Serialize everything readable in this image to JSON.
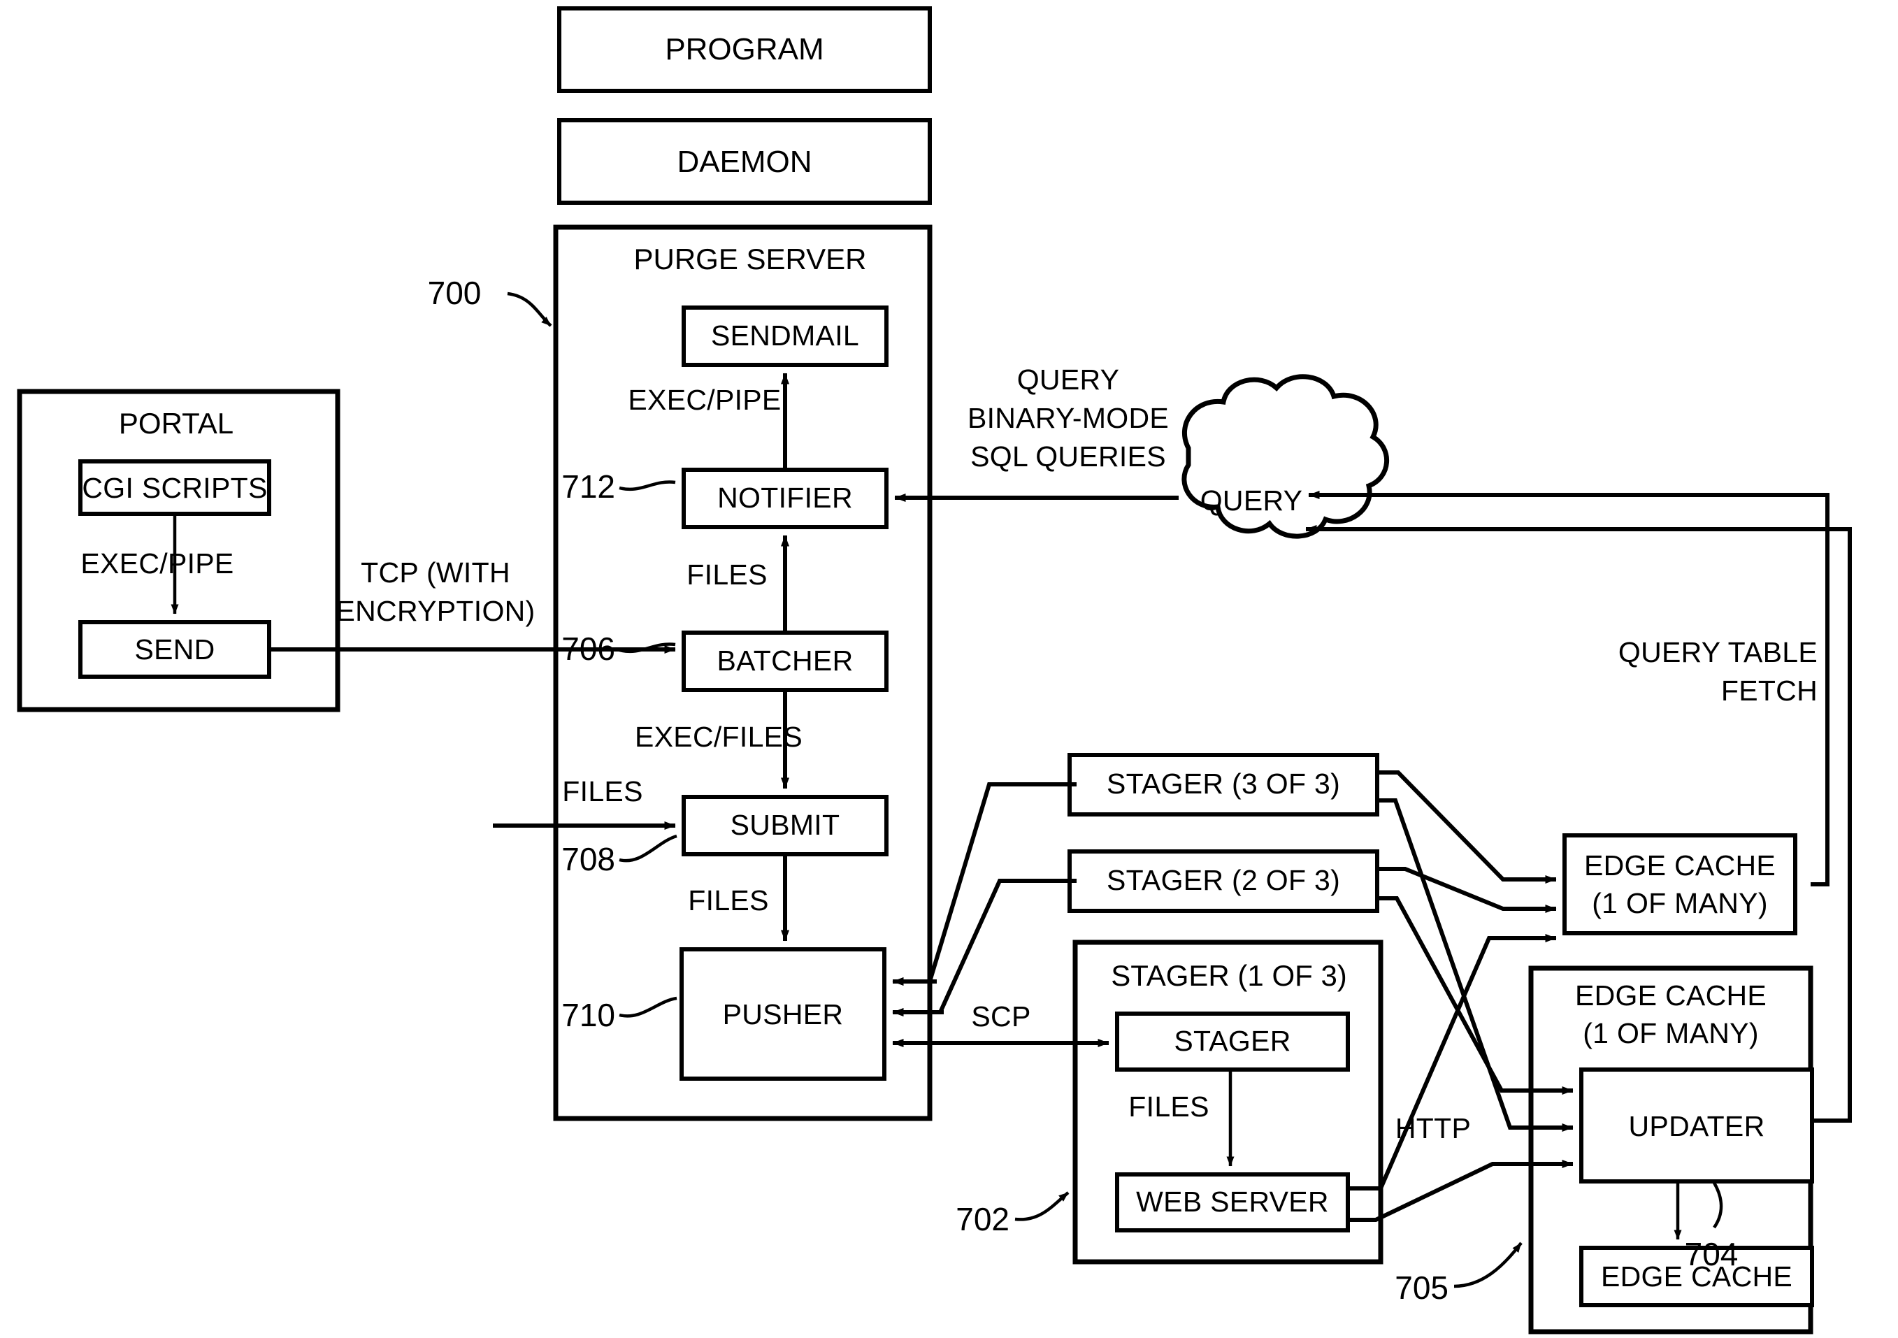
{
  "figure": {
    "type": "patent-block-diagram",
    "reference_numerals": [
      "700",
      "702",
      "704",
      "705",
      "706",
      "708",
      "710",
      "712"
    ]
  },
  "boxes": {
    "program": "PROGRAM",
    "daemon": "DAEMON",
    "purge_server": "PURGE SERVER",
    "sendmail": "SENDMAIL",
    "notifier": "NOTIFIER",
    "batcher": "BATCHER",
    "submit": "SUBMIT",
    "pusher": "PUSHER",
    "portal": "PORTAL",
    "cgi_scripts": "CGI SCRIPTS",
    "send": "SEND",
    "query_cloud": "QUERY",
    "stager_3": "STAGER (3 OF 3)",
    "stager_2": "STAGER (2 OF 3)",
    "stager_1_container": "STAGER (1 OF 3)",
    "stager": "STAGER",
    "web_server": "WEB SERVER",
    "edge_cache_many_top_l1": "EDGE CACHE",
    "edge_cache_many_top_l2": "(1 OF MANY)",
    "edge_cache_many_bottom_l1": "EDGE CACHE",
    "edge_cache_many_bottom_l2": "(1 OF MANY)",
    "updater": "UPDATER",
    "edge_cache": "EDGE CACHE"
  },
  "edge_labels": {
    "exec_pipe_portal": "EXEC/PIPE",
    "exec_pipe_notifier": "EXEC/PIPE",
    "tcp_line1": "TCP (WITH",
    "tcp_line2": "ENCRYPTION)",
    "files_notifier": "FILES",
    "exec_files": "EXEC/FILES",
    "files_submit_in": "FILES",
    "files_pusher": "FILES",
    "files_stager": "FILES",
    "scp": "SCP",
    "http": "HTTP",
    "query_line1": "QUERY",
    "query_line2": "BINARY-MODE",
    "query_line3": "SQL QUERIES",
    "query_table_line1": "QUERY TABLE",
    "query_table_line2": "FETCH"
  },
  "numerals": {
    "n700": "700",
    "n702": "702",
    "n704": "704",
    "n705": "705",
    "n706": "706",
    "n708": "708",
    "n710": "710",
    "n712": "712"
  },
  "colors": {
    "stroke": "#000000",
    "fill": "#ffffff"
  }
}
